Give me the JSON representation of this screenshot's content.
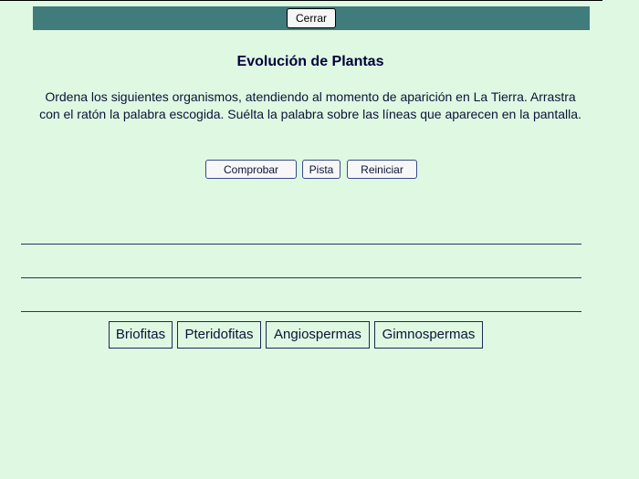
{
  "header": {
    "close_label": "Cerrar"
  },
  "activity": {
    "title": "Evolución de Plantas",
    "instructions": "Ordena los siguientes organismos, atendiendo al momento de aparición en La Tierra. Arrastra con el ratón la palabra escogida. Suélta la palabra sobre las líneas que aparecen en la pantalla."
  },
  "controls": {
    "check_label": "Comprobar",
    "hint_label": "Pista",
    "reset_label": "Reiniciar"
  },
  "words": [
    {
      "label": "Briofitas"
    },
    {
      "label": "Pteridofitas"
    },
    {
      "label": "Angiospermas"
    },
    {
      "label": "Gimnospermas"
    }
  ],
  "colors": {
    "background": "#dff8e2",
    "header_bar": "#407c7b",
    "text": "#0b1438"
  }
}
